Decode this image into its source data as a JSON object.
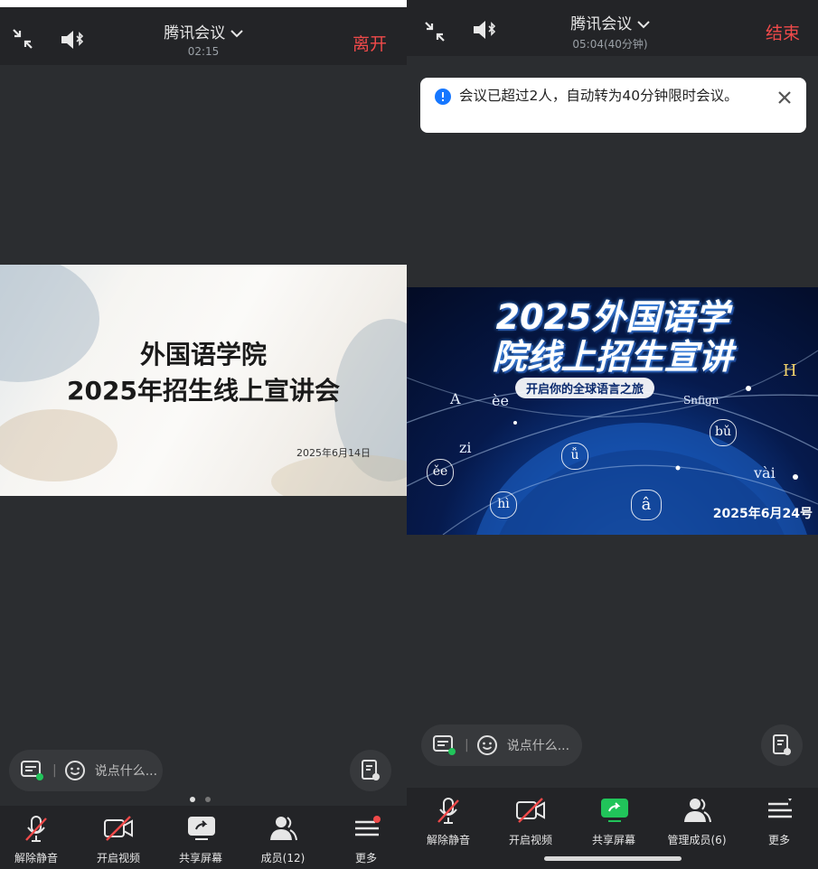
{
  "left": {
    "topbar": {
      "title": "腾讯会议",
      "timer": "02:15",
      "leave_label": "离开"
    },
    "slide": {
      "title_line1": "外国语学院",
      "title_line2": "2025年招生线上宣讲会",
      "date": "2025年6月14日"
    },
    "chat": {
      "placeholder": "说点什么..."
    },
    "toolbar": [
      {
        "label": "解除静音",
        "icon": "mic-muted-icon"
      },
      {
        "label": "开启视频",
        "icon": "video-off-icon"
      },
      {
        "label": "共享屏幕",
        "icon": "share-screen-icon"
      },
      {
        "label": "成员(12)",
        "icon": "members-icon"
      },
      {
        "label": "更多",
        "icon": "more-menu-icon"
      }
    ],
    "page_dots": {
      "count": 2,
      "active": 1
    }
  },
  "right": {
    "topbar": {
      "title": "腾讯会议",
      "timer": "05:04(40分钟)",
      "end_label": "结束"
    },
    "notice": {
      "text": "会议已超过2人，自动转为40分钟限时会议。"
    },
    "slide": {
      "title_line1": "2025外国语学",
      "title_line2": "院线上招生宣讲",
      "tagline": "开启你的全球语言之旅",
      "date": "2025年6月24号",
      "letters": [
        "A",
        "èe",
        "Snfign",
        "H",
        "zi",
        "bǔ",
        "ǚ",
        "ěe",
        "vài",
        "hì",
        "â"
      ]
    },
    "chat": {
      "placeholder": "说点什么..."
    },
    "toolbar": [
      {
        "label": "解除静音",
        "icon": "mic-muted-icon"
      },
      {
        "label": "开启视频",
        "icon": "video-off-icon"
      },
      {
        "label": "共享屏幕",
        "icon": "share-screen-icon"
      },
      {
        "label": "管理成员(6)",
        "icon": "members-icon"
      },
      {
        "label": "更多",
        "icon": "more-menu-icon"
      }
    ]
  },
  "colors": {
    "background": "#2b2d30",
    "bar": "#232427",
    "danger": "#f04a4a",
    "share_green": "#21c45a",
    "notice_blue": "#1677ff"
  }
}
